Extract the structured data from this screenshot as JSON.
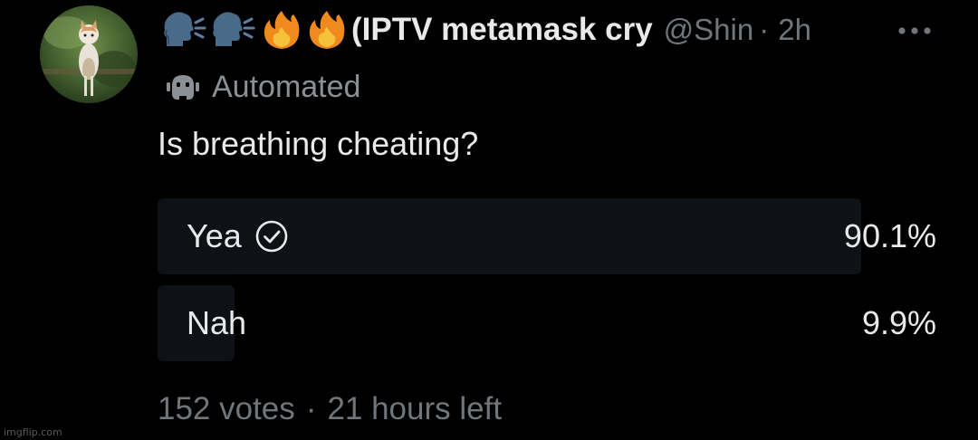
{
  "tweet": {
    "display_name": "(IPTV metamask cry",
    "handle": "@Shin",
    "separator": "·",
    "time": "2h",
    "name_emojis": [
      "speaking-head-emoji",
      "speaking-head-emoji",
      "fire-emoji",
      "fire-emoji"
    ],
    "automated_label": "Automated",
    "text": "Is breathing cheating?"
  },
  "poll": {
    "options": [
      {
        "label": "Yea",
        "percent_text": "90.1%",
        "percent": 90.1,
        "winner": true
      },
      {
        "label": "Nah",
        "percent_text": "9.9%",
        "percent": 9.9,
        "winner": false
      }
    ],
    "votes": "152 votes",
    "separator": "·",
    "time_left": "21 hours left"
  },
  "colors": {
    "background": "#000000",
    "text_primary": "#e7e9ea",
    "text_secondary": "#71767b",
    "poll_bar": "#0e1115"
  },
  "icons": {
    "more": "more-horizontal-icon",
    "automated": "bot-icon",
    "winner": "check-circle-icon"
  },
  "watermark": "imgflip.com"
}
